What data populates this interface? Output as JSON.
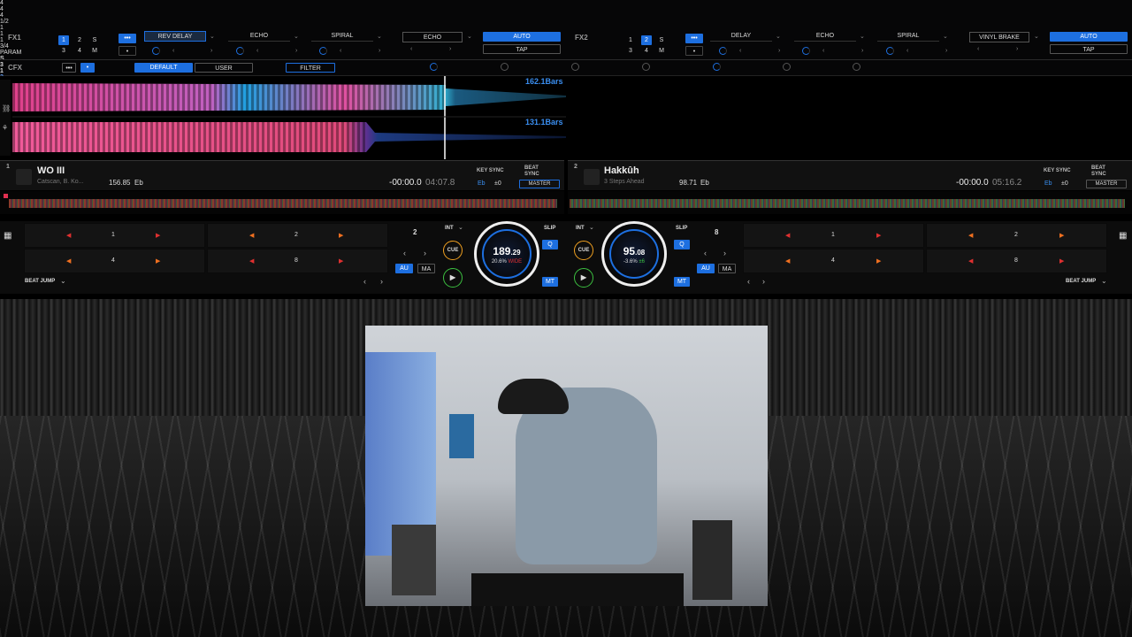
{
  "fx1": {
    "label": "FX1",
    "slots": [
      "1",
      "2",
      "S",
      "3",
      "4",
      "M"
    ],
    "effects": [
      "REV DELAY",
      "ECHO",
      "SPIRAL"
    ],
    "values": [
      "4",
      "4",
      "4"
    ],
    "beat_effect": "ECHO",
    "beat": "1/2",
    "auto": "AUTO",
    "tap": "TAP"
  },
  "fx2": {
    "label": "FX2",
    "slots": [
      "1",
      "2",
      "S",
      "3",
      "4",
      "M"
    ],
    "effects": [
      "DELAY",
      "ECHO",
      "SPIRAL"
    ],
    "values": [
      "1",
      "1",
      "1"
    ],
    "beat_effect": "VINYL BRAKE",
    "beat": "3/4",
    "auto": "AUTO",
    "tap": "TAP"
  },
  "cfx": {
    "label": "CFX",
    "default": "DEFAULT",
    "user": "USER",
    "filter": "FILTER",
    "param": "PARAM",
    "s": "S",
    "val1": "3",
    "val2": "1",
    "val3": "2",
    "val4": "4",
    "m": "M"
  },
  "waveform": {
    "bars_top": "162.1Bars",
    "bars_bottom": "131.1Bars"
  },
  "deck1": {
    "num": "1",
    "title": "WO III",
    "artist": "Catscan, B. Ko...",
    "bpm": "156.85",
    "key": "Eb",
    "time": "-00:00.0",
    "remain": "04:07.8",
    "key_sync": "KEY SYNC",
    "beat_sync": "BEAT SYNC",
    "key_val": "Eb",
    "offset": "±0",
    "master": "MASTER",
    "tempo_big": "189",
    "tempo_dec": ".29",
    "pitch": "20.6%",
    "range": "WIDE",
    "beat_jump": "BEAT JUMP",
    "jump_val": "2",
    "pads": [
      "1",
      "2",
      "4",
      "8"
    ],
    "int": "INT",
    "cue": "CUE",
    "slip": "SLIP",
    "q": "Q",
    "au": "AU",
    "ma": "MA",
    "mt": "MT"
  },
  "deck2": {
    "num": "2",
    "title": "Hakkûh",
    "artist": "3 Steps Ahead",
    "bpm": "98.71",
    "key": "Eb",
    "time": "-00:00.0",
    "remain": "05:16.2",
    "key_sync": "KEY SYNC",
    "beat_sync": "BEAT SYNC",
    "key_val": "Eb",
    "offset": "±0",
    "master": "MASTER",
    "tempo_big": "95",
    "tempo_dec": ".08",
    "pitch": "-3.6%",
    "range": "±6",
    "beat_jump": "BEAT JUMP",
    "jump_val": "8",
    "pads": [
      "1",
      "2",
      "4",
      "8"
    ],
    "int": "INT",
    "cue": "CUE",
    "slip": "SLIP",
    "q": "Q",
    "au": "AU",
    "ma": "MA",
    "mt": "MT"
  },
  "colors": {
    "accent": "#1d6fe0",
    "cue": "#f0a020",
    "play": "#3cc040",
    "pad_marker": "#e03030"
  },
  "icons": [
    "grid-icon",
    "link-icon",
    "arrow-left-icon",
    "arrow-right-icon",
    "play-icon",
    "chevron-down-icon",
    "menu-dots-icon"
  ]
}
